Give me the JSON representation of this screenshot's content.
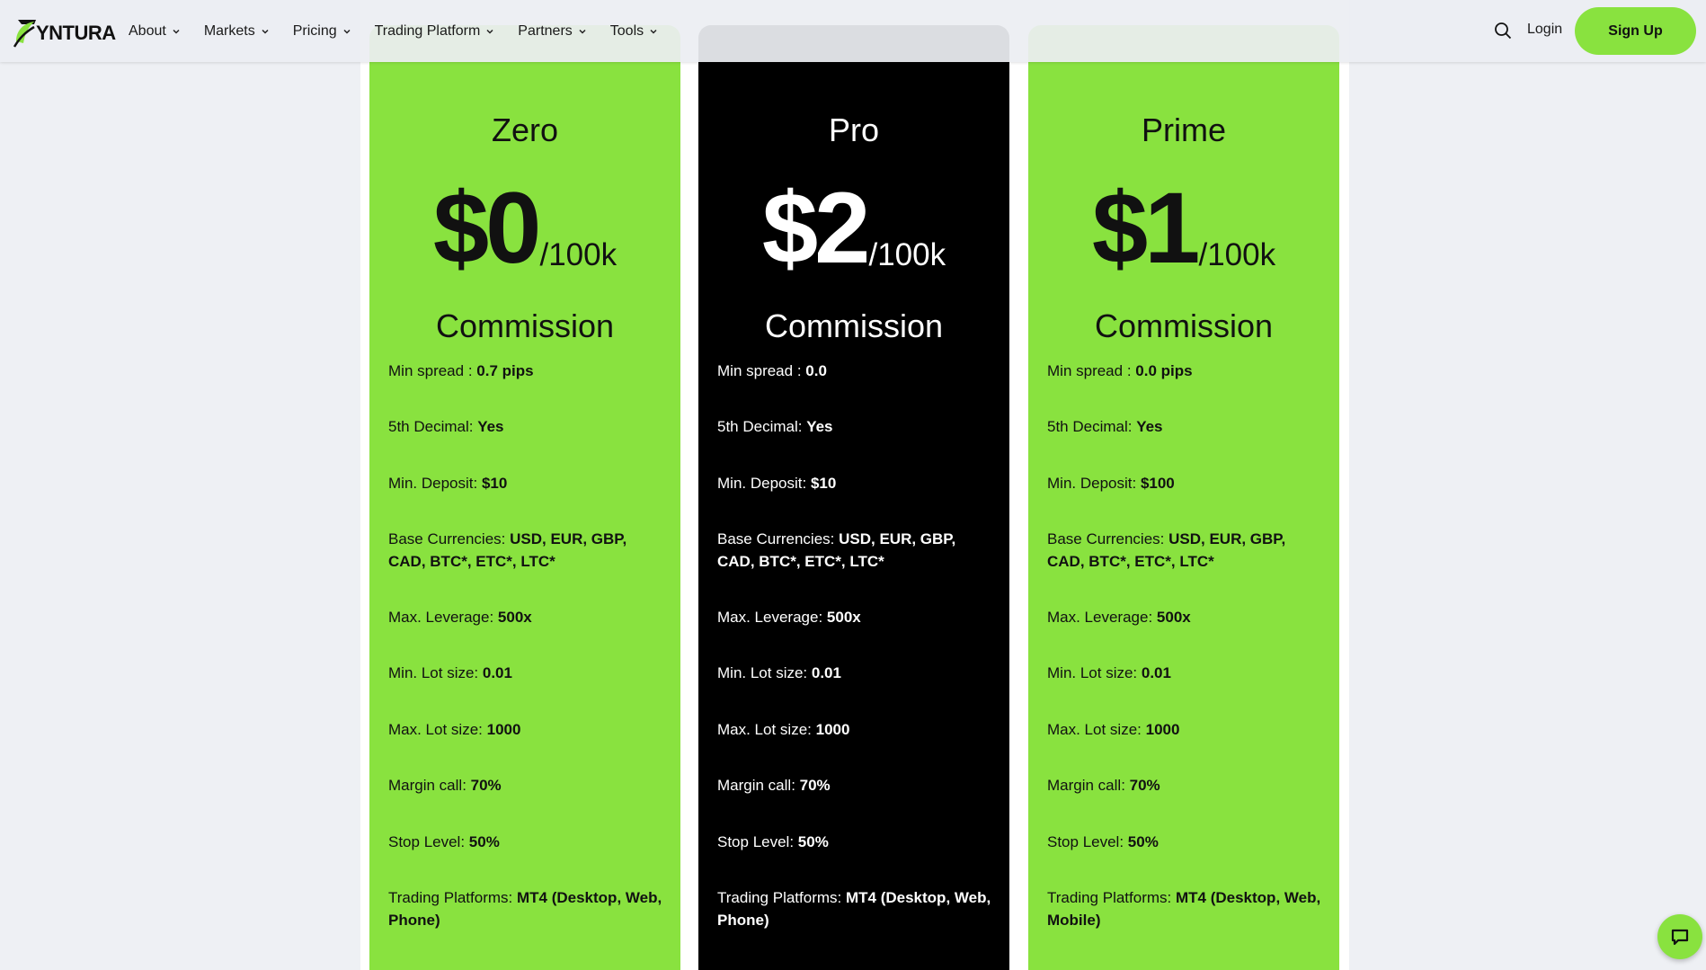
{
  "brand": {
    "name": "YNTURA",
    "accent": "#89e23f"
  },
  "nav": {
    "items": [
      {
        "label": "About"
      },
      {
        "label": "Markets"
      },
      {
        "label": "Pricing"
      },
      {
        "label": "Trading Platform"
      },
      {
        "label": "Partners"
      },
      {
        "label": "Tools"
      }
    ],
    "login": "Login",
    "signup": "Sign Up"
  },
  "plans": [
    {
      "name": "Zero",
      "price": "$0",
      "unit": "/100k",
      "commission": "Commission",
      "features": [
        {
          "label": "Min spread : ",
          "value": "0.7 pips"
        },
        {
          "label": "5th Decimal: ",
          "value": "Yes"
        },
        {
          "label": "Min. Deposit: ",
          "value": "$10"
        },
        {
          "label": "Base Currencies: ",
          "value": "USD, EUR, GBP, CAD, BTC*, ETC*, LTC*"
        },
        {
          "label": "Max. Leverage: ",
          "value": "500x"
        },
        {
          "label": "Min. Lot size: ",
          "value": "0.01"
        },
        {
          "label": "Max. Lot size: ",
          "value": "1000"
        },
        {
          "label": "Margin call: ",
          "value": "70%"
        },
        {
          "label": "Stop Level: ",
          "value": "50%"
        },
        {
          "label": "Trading Platforms: ",
          "value": "MT4 (Desktop, Web, Phone)"
        }
      ]
    },
    {
      "name": "Pro",
      "price": "$2",
      "unit": "/100k",
      "commission": "Commission",
      "features": [
        {
          "label": "Min spread : ",
          "value": "0.0"
        },
        {
          "label": "5th Decimal: ",
          "value": "Yes"
        },
        {
          "label": "Min. Deposit: ",
          "value": "$10"
        },
        {
          "label": "Base Currencies: ",
          "value": "USD, EUR, GBP, CAD, BTC*, ETC*, LTC*"
        },
        {
          "label": "Max. Leverage: ",
          "value": "500x"
        },
        {
          "label": "Min. Lot size: ",
          "value": "0.01"
        },
        {
          "label": "Max. Lot size: ",
          "value": "1000"
        },
        {
          "label": "Margin call: ",
          "value": "70%"
        },
        {
          "label": "Stop Level: ",
          "value": "50%"
        },
        {
          "label": "Trading Platforms: ",
          "value": "MT4 (Desktop, Web, Phone)"
        }
      ]
    },
    {
      "name": "Prime",
      "price": "$1",
      "unit": "/100k",
      "commission": "Commission",
      "features": [
        {
          "label": "Min spread : ",
          "value": "0.0 pips"
        },
        {
          "label": "5th Decimal: ",
          "value": "Yes"
        },
        {
          "label": "Min. Deposit: ",
          "value": "$100"
        },
        {
          "label": "Base Currencies: ",
          "value": "USD, EUR, GBP, CAD, BTC*, ETC*, LTC*"
        },
        {
          "label": "Max. Leverage: ",
          "value": "500x"
        },
        {
          "label": "Min. Lot size: ",
          "value": "0.01"
        },
        {
          "label": "Max. Lot size: ",
          "value": "1000"
        },
        {
          "label": "Margin call: ",
          "value": "70%"
        },
        {
          "label": "Stop Level: ",
          "value": "50%"
        },
        {
          "label": "Trading Platforms: ",
          "value": "MT4 (Desktop, Web, Mobile)"
        }
      ]
    }
  ],
  "icons": {
    "search": "search-icon",
    "chat": "chat-icon",
    "chevron": "chevron-down-icon"
  }
}
